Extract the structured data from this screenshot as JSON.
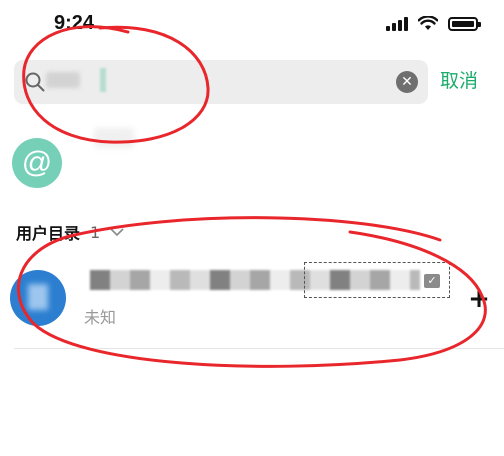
{
  "status_bar": {
    "time": "9:24"
  },
  "search": {
    "value": "",
    "placeholder": ""
  },
  "cancel_label": "取消",
  "mention_symbol": "@",
  "section": {
    "title": "用户目录",
    "count": "1"
  },
  "user": {
    "status": "未知"
  },
  "icons": {
    "search": "search-icon",
    "clear": "clear-icon",
    "chevron": "chevron-down-icon",
    "add": "plus-icon",
    "check": "checkmark-icon"
  },
  "colors": {
    "accent": "#1aad6b",
    "mention_avatar": "#76d0b8",
    "user_avatar": "#2c7fd0",
    "annotation": "#e8262b"
  }
}
